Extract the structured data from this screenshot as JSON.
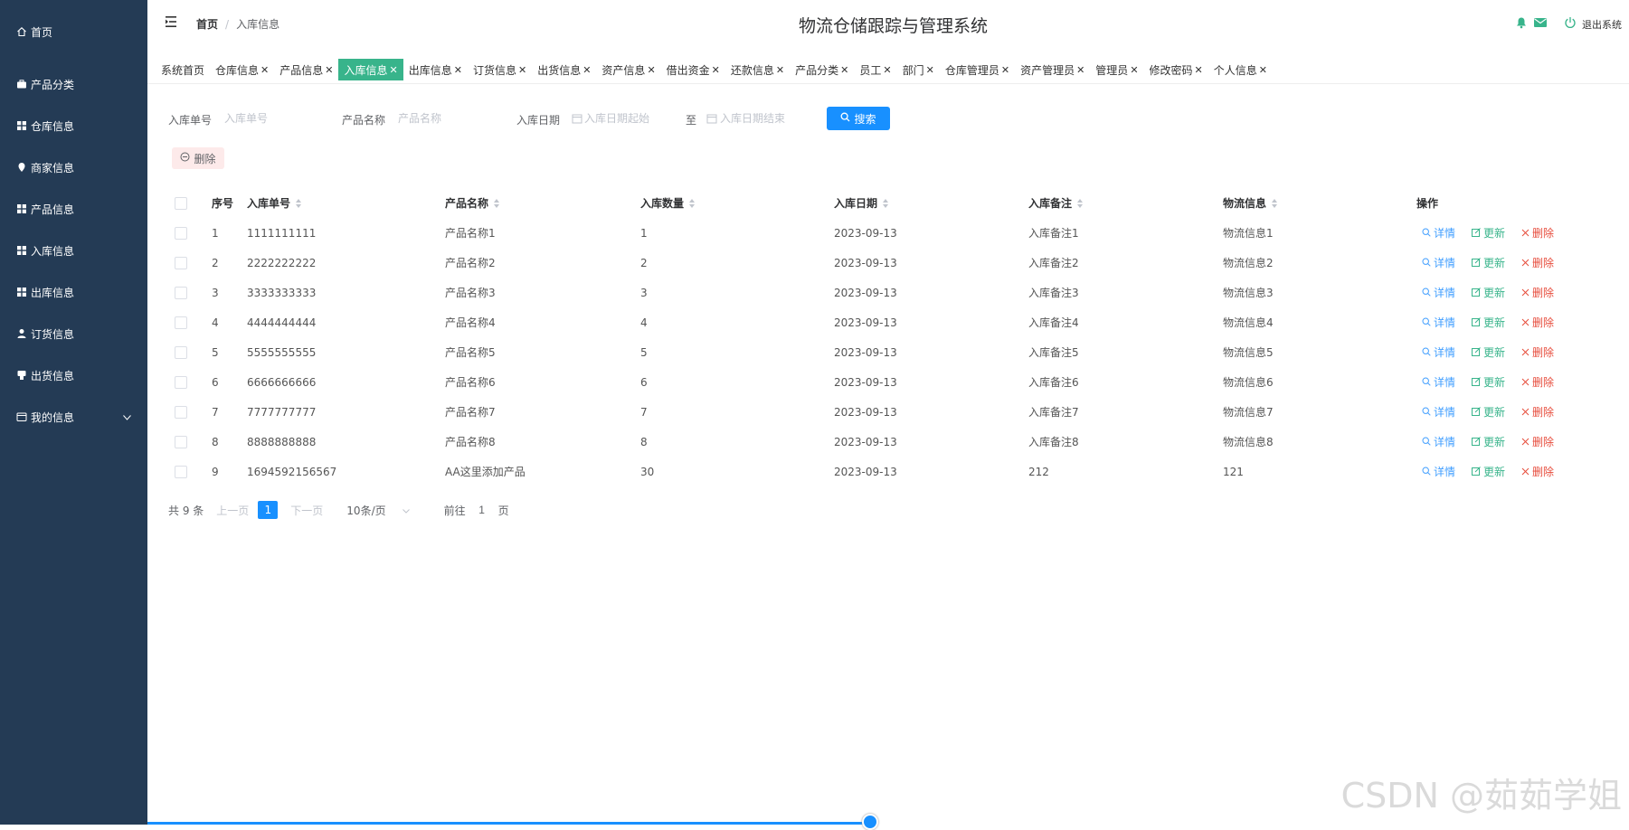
{
  "sidebar": {
    "items": [
      {
        "label": "首页",
        "icon": "home-icon"
      },
      {
        "label": "产品分类",
        "icon": "briefcase-icon"
      },
      {
        "label": "仓库信息",
        "icon": "grid-icon"
      },
      {
        "label": "商家信息",
        "icon": "location-icon"
      },
      {
        "label": "产品信息",
        "icon": "grid-icon"
      },
      {
        "label": "入库信息",
        "icon": "grid-icon"
      },
      {
        "label": "出库信息",
        "icon": "grid-icon"
      },
      {
        "label": "订货信息",
        "icon": "user-icon"
      },
      {
        "label": "出货信息",
        "icon": "phone-icon"
      },
      {
        "label": "我的信息",
        "icon": "wallet-icon"
      }
    ]
  },
  "header": {
    "breadcrumb_home": "首页",
    "breadcrumb_sep": "/",
    "breadcrumb_current": "入库信息",
    "title": "物流仓储跟踪与管理系统",
    "logout": "退出系统"
  },
  "tabs": [
    {
      "label": "系统首页",
      "closable": false
    },
    {
      "label": "仓库信息",
      "closable": true
    },
    {
      "label": "产品信息",
      "closable": true
    },
    {
      "label": "入库信息",
      "closable": true,
      "active": true
    },
    {
      "label": "出库信息",
      "closable": true
    },
    {
      "label": "订货信息",
      "closable": true
    },
    {
      "label": "出货信息",
      "closable": true
    },
    {
      "label": "资产信息",
      "closable": true
    },
    {
      "label": "借出资金",
      "closable": true
    },
    {
      "label": "还款信息",
      "closable": true
    },
    {
      "label": "产品分类",
      "closable": true
    },
    {
      "label": "员工",
      "closable": true
    },
    {
      "label": "部门",
      "closable": true
    },
    {
      "label": "仓库管理员",
      "closable": true
    },
    {
      "label": "资产管理员",
      "closable": true
    },
    {
      "label": "管理员",
      "closable": true
    },
    {
      "label": "修改密码",
      "closable": true
    },
    {
      "label": "个人信息",
      "closable": true
    }
  ],
  "search": {
    "order_label": "入库单号",
    "order_placeholder": "入库单号",
    "product_label": "产品名称",
    "product_placeholder": "产品名称",
    "date_label": "入库日期",
    "date_start_placeholder": "入库日期起始",
    "date_to": "至",
    "date_end_placeholder": "入库日期结束",
    "search_button": "搜索"
  },
  "delete_button": "删除",
  "table": {
    "columns": [
      "序号",
      "入库单号",
      "产品名称",
      "入库数量",
      "入库日期",
      "入库备注",
      "物流信息",
      "操作"
    ],
    "actions": {
      "detail": "详情",
      "update": "更新",
      "delete": "删除"
    },
    "rows": [
      [
        "1",
        "1111111111",
        "产品名称1",
        "1",
        "2023-09-13",
        "入库备注1",
        "物流信息1"
      ],
      [
        "2",
        "2222222222",
        "产品名称2",
        "2",
        "2023-09-13",
        "入库备注2",
        "物流信息2"
      ],
      [
        "3",
        "3333333333",
        "产品名称3",
        "3",
        "2023-09-13",
        "入库备注3",
        "物流信息3"
      ],
      [
        "4",
        "4444444444",
        "产品名称4",
        "4",
        "2023-09-13",
        "入库备注4",
        "物流信息4"
      ],
      [
        "5",
        "5555555555",
        "产品名称5",
        "5",
        "2023-09-13",
        "入库备注5",
        "物流信息5"
      ],
      [
        "6",
        "6666666666",
        "产品名称6",
        "6",
        "2023-09-13",
        "入库备注6",
        "物流信息6"
      ],
      [
        "7",
        "7777777777",
        "产品名称7",
        "7",
        "2023-09-13",
        "入库备注7",
        "物流信息7"
      ],
      [
        "8",
        "8888888888",
        "产品名称8",
        "8",
        "2023-09-13",
        "入库备注8",
        "物流信息8"
      ],
      [
        "9",
        "1694592156567",
        "AA这里添加产品",
        "30",
        "2023-09-13",
        "212",
        "121"
      ]
    ]
  },
  "pagination": {
    "total": "共 9 条",
    "prev": "上一页",
    "current": "1",
    "next": "下一页",
    "page_size": "10条/页",
    "goto_prefix": "前往",
    "goto_value": "1",
    "goto_suffix": "页"
  },
  "watermark": "CSDN @茹茹学姐",
  "colors": {
    "sidebar_bg": "#243b55",
    "active_tab": "#38b48b",
    "primary": "#1890ff",
    "danger": "#e74c3c"
  }
}
